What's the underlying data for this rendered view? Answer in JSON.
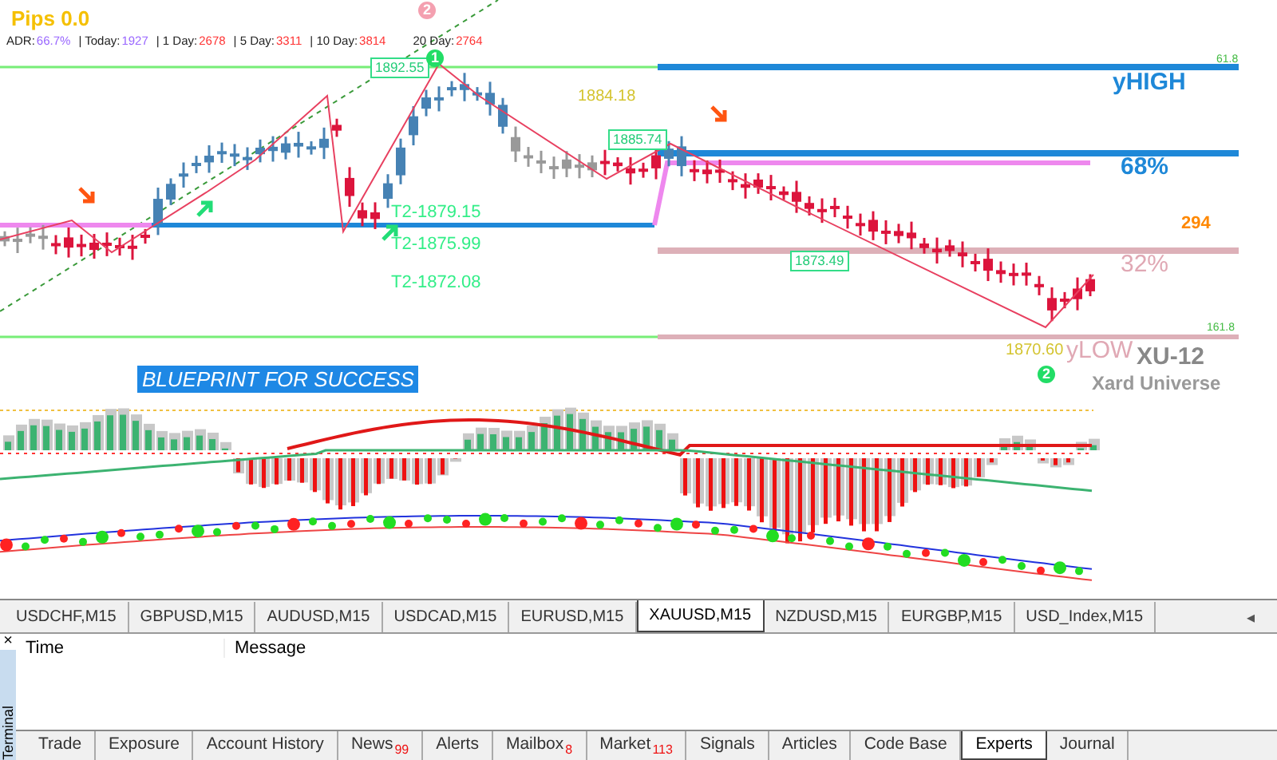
{
  "chart": {
    "pips": "Pips 0.0",
    "adr": [
      {
        "label": "ADR:",
        "value": "66.7%",
        "color": "#9966ff"
      },
      {
        "label": "| Today:",
        "value": "1927",
        "color": "#9966ff"
      },
      {
        "label": "| 1 Day:",
        "value": "2678",
        "color": "#ff3333"
      },
      {
        "label": "| 5 Day:",
        "value": "3311",
        "color": "#ff3333"
      },
      {
        "label": "| 10 Day:",
        "value": "3814",
        "color": "#ff3333"
      },
      {
        "label": "20 Day:",
        "value": "2764",
        "color": "#ff3333"
      }
    ],
    "price_boxes": [
      "1892.55",
      "1885.74",
      "1873.49"
    ],
    "price_texts": [
      "1884.18",
      "1870.60"
    ],
    "targets": [
      "T2-1879.15",
      "T2-1875.99",
      "T2-1872.08"
    ],
    "levels": [
      {
        "text": "yHIGH",
        "kind": "high"
      },
      {
        "text": "68%",
        "kind": "pct-high"
      },
      {
        "text": "294",
        "kind": "adr"
      },
      {
        "text": "32%",
        "kind": "pct-low"
      },
      {
        "text": "yLOW",
        "kind": "low"
      }
    ],
    "fib_labels": [
      "61.8",
      "161.8"
    ],
    "markers": [
      {
        "text": "2",
        "color": "#f4a0b0"
      },
      {
        "text": "1",
        "color": "#22dd66"
      },
      {
        "text": "2",
        "color": "#22dd66"
      }
    ],
    "brand": {
      "title": "XU-12",
      "subtitle": "Xard Universe"
    },
    "banner": "BLUEPRINT FOR SUCCESS"
  },
  "symbol_tabs": [
    {
      "label": "USDCHF,M15",
      "selected": false
    },
    {
      "label": "GBPUSD,M15",
      "selected": false
    },
    {
      "label": "AUDUSD,M15",
      "selected": false
    },
    {
      "label": "USDCAD,M15",
      "selected": false
    },
    {
      "label": "EURUSD,M15",
      "selected": false
    },
    {
      "label": "XAUUSD,M15",
      "selected": true
    },
    {
      "label": "NZDUSD,M15",
      "selected": false
    },
    {
      "label": "EURGBP,M15",
      "selected": false
    },
    {
      "label": "USD_Index,M15",
      "selected": false
    }
  ],
  "tab_scroll": "◂",
  "terminal": {
    "close": "×",
    "side_label": "Terminal",
    "columns": [
      "Time",
      "Message"
    ],
    "tabs": [
      {
        "label": "Trade",
        "selected": false
      },
      {
        "label": "Exposure",
        "selected": false
      },
      {
        "label": "Account History",
        "selected": false
      },
      {
        "label": "News",
        "badge": "99",
        "selected": false
      },
      {
        "label": "Alerts",
        "selected": false
      },
      {
        "label": "Mailbox",
        "badge": "8",
        "selected": false
      },
      {
        "label": "Market",
        "badge": "113",
        "selected": false
      },
      {
        "label": "Signals",
        "selected": false
      },
      {
        "label": "Articles",
        "selected": false
      },
      {
        "label": "Code Base",
        "selected": false
      },
      {
        "label": "Experts",
        "selected": true
      },
      {
        "label": "Journal",
        "selected": false
      }
    ]
  }
}
